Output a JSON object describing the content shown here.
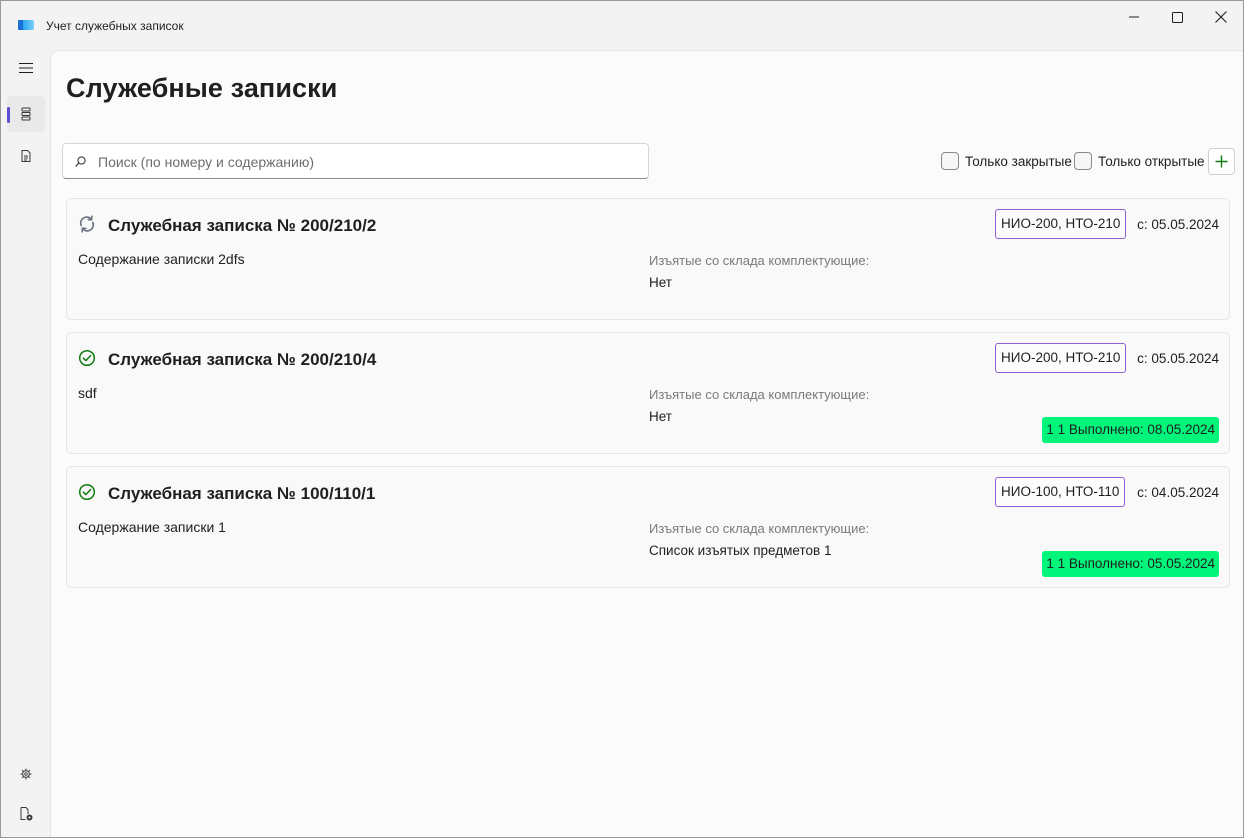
{
  "window": {
    "title": "Учет служебных записок",
    "accent_color": "#5b4fd6"
  },
  "rail": {
    "items": [
      {
        "icon": "hamburger-menu-icon"
      },
      {
        "icon": "list-icon",
        "active": true
      },
      {
        "icon": "document-icon"
      },
      {
        "icon": "gear-icon"
      },
      {
        "icon": "document-settings-icon"
      }
    ]
  },
  "page": {
    "title": "Служебные записки"
  },
  "search": {
    "placeholder": "Поиск (по номеру и содержанию)",
    "value": ""
  },
  "filters": {
    "only_closed": {
      "label": "Только закрытые",
      "checked": false
    },
    "only_open": {
      "label": "Только открытые",
      "checked": false
    }
  },
  "add_button": {
    "icon": "plus-icon",
    "color": "#107c10"
  },
  "notes": [
    {
      "status": "in-progress",
      "title": "Служебная записка № 200/210/2",
      "content": "Содержание записки 2dfs",
      "removed_label": "Изъятые со склада комплектующие:",
      "removed_value": "Нет",
      "departments": "НИО-200, НТО-210",
      "date": "с: 05.05.2024",
      "done": ""
    },
    {
      "status": "done",
      "title": "Служебная записка № 200/210/4",
      "content": "sdf",
      "removed_label": "Изъятые со склада комплектующие:",
      "removed_value": "Нет",
      "departments": "НИО-200, НТО-210",
      "date": "с: 05.05.2024",
      "done": "1 1 Выполнено: 08.05.2024"
    },
    {
      "status": "done",
      "title": "Служебная записка № 100/110/1",
      "content": "Содержание записки 1",
      "removed_label": "Изъятые со склада комплектующие:",
      "removed_value": "Список изъятых предметов 1",
      "departments": "НИО-100, НТО-110",
      "date": "с: 04.05.2024",
      "done": "1 1 Выполнено: 05.05.2024"
    }
  ],
  "colors": {
    "done_badge": "#00f57a",
    "dept_border": "#8e5fd0",
    "done_icon": "#107c10",
    "sync_icon": "#6b7280"
  }
}
